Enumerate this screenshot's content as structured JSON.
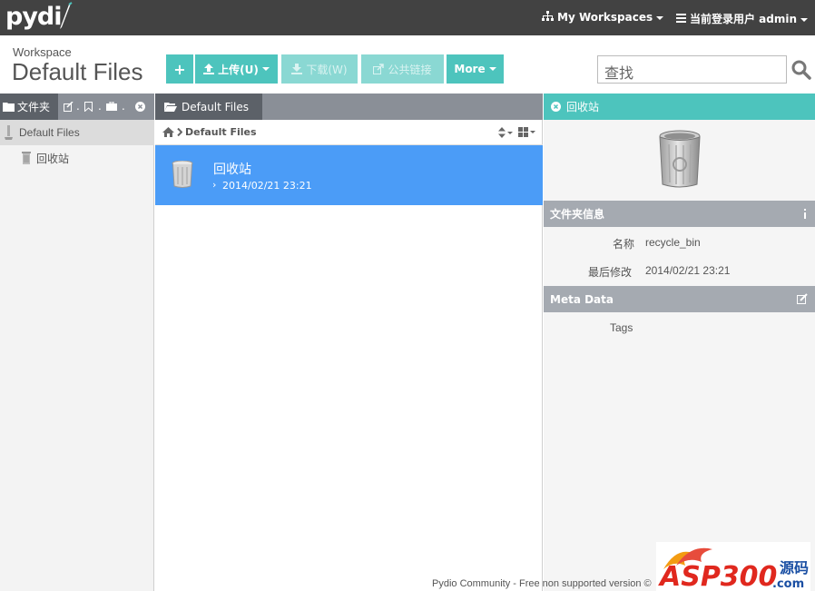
{
  "app": {
    "logo_text": "pydi"
  },
  "topbar": {
    "workspaces_label": "My Workspaces",
    "user_label": "当前登录用户 admin"
  },
  "workspace": {
    "label": "Workspace",
    "title": "Default Files"
  },
  "toolbar": {
    "new_label": "+",
    "upload_label": "上传(U)",
    "download_label": "下载(W)",
    "share_label": "公共链接",
    "more_label": "More"
  },
  "search": {
    "placeholder": "查找"
  },
  "left_panel": {
    "tab_label": "文件夹",
    "tree": [
      {
        "label": "Default Files"
      },
      {
        "label": "回收站"
      }
    ]
  },
  "middle_panel": {
    "tab_label": "Default Files",
    "breadcrumb": "Default Files",
    "files": [
      {
        "name": "回收站",
        "modified": "2014/02/21 23:21"
      }
    ]
  },
  "right_panel": {
    "title": "回收站",
    "folder_info": {
      "heading": "文件夹信息",
      "name_label": "名称",
      "name_value": "recycle_bin",
      "modified_label": "最后修改",
      "modified_value": "2014/02/21 23:21"
    },
    "meta": {
      "heading": "Meta Data",
      "tags_label": "Tags"
    }
  },
  "footer": {
    "text": "Pydio Community - Free non supported version ©"
  },
  "watermark": {
    "text": "ASP300",
    "sub": "源码",
    "domain": ".com"
  },
  "colors": {
    "topbar": "#424242",
    "accent": "#4dc4bd",
    "selection": "#4b9cf7",
    "panel_header": "#8a8f97"
  }
}
